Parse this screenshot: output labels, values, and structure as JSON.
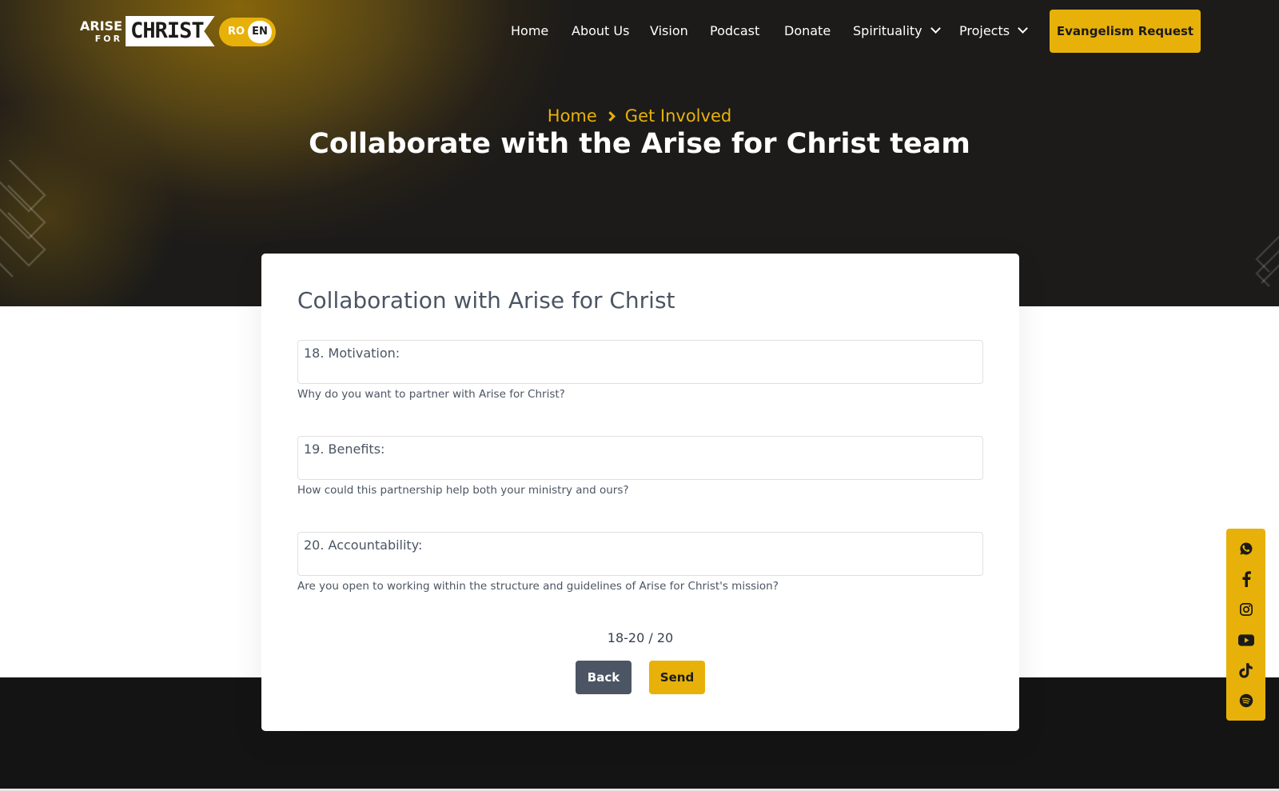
{
  "header": {
    "logo": {
      "top": "ARISE",
      "mid": "FOR",
      "main": "CHRIST"
    },
    "lang": {
      "ro": "RO",
      "en": "EN"
    },
    "nav": [
      {
        "label": "Home"
      },
      {
        "label": "About Us"
      },
      {
        "label": "Vision"
      },
      {
        "label": "Podcast"
      },
      {
        "label": "Donate"
      },
      {
        "label": "Spirituality",
        "dropdown": true
      },
      {
        "label": "Projects",
        "dropdown": true
      }
    ],
    "cta": "Evangelism Request"
  },
  "hero": {
    "breadcrumb": {
      "home": "Home",
      "current": "Get Involved"
    },
    "title": "Collaborate with the Arise for Christ team"
  },
  "form": {
    "title": "Collaboration with Arise for Christ",
    "fields": [
      {
        "label": "18. Motivation:",
        "value": "",
        "hint": "Why do you want to partner with Arise for Christ?"
      },
      {
        "label": "19. Benefits:",
        "value": "",
        "hint": "How could this partnership help both your ministry and ours?"
      },
      {
        "label": "20. Accountability:",
        "value": "",
        "hint": "Are you open to working within the structure and guidelines of Arise for Christ's mission?"
      }
    ],
    "progress": "18-20 / 20",
    "back": "Back",
    "send": "Send"
  },
  "social": [
    "whatsapp-icon",
    "facebook-icon",
    "instagram-icon",
    "youtube-icon",
    "tiktok-icon",
    "spotify-icon"
  ],
  "colors": {
    "accent": "#e8b10a",
    "dark": "#1c1b19",
    "slate": "#4b5563"
  }
}
